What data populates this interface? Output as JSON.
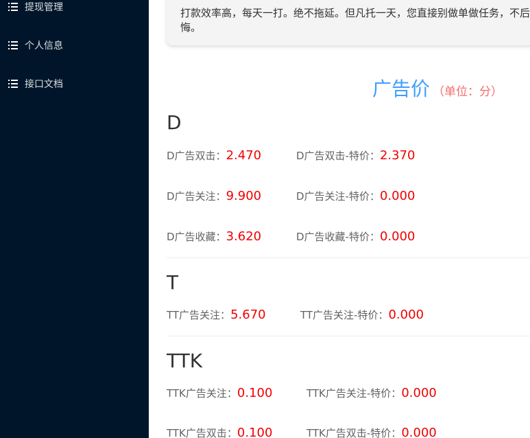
{
  "sidebar": {
    "items": [
      {
        "label": "提现管理",
        "icon": "list-icon"
      },
      {
        "label": "个人信息",
        "icon": "list-icon"
      },
      {
        "label": "接口文档",
        "icon": "list-icon"
      }
    ]
  },
  "notice": {
    "text": "打款效率高，每天一打。绝不拖延。但凡托一天，您直接别做单做任务，不后悔。"
  },
  "price": {
    "title": "广告价",
    "unit": "（单位：分）",
    "groups": [
      {
        "name": "D",
        "rows": [
          [
            {
              "label": "D广告双击：",
              "value": "2.470"
            },
            {
              "label": "D广告双击-特价：",
              "value": "2.370"
            }
          ],
          [
            {
              "label": "D广告关注：",
              "value": "9.900"
            },
            {
              "label": "D广告关注-特价：",
              "value": "0.000"
            }
          ],
          [
            {
              "label": "D广告收藏：",
              "value": "3.620"
            },
            {
              "label": "D广告收藏-特价：",
              "value": "0.000"
            }
          ]
        ]
      },
      {
        "name": "T",
        "rows": [
          [
            {
              "label": "TT广告关注：",
              "value": "5.670"
            },
            {
              "label": "TT广告关注-特价：",
              "value": "0.000"
            }
          ]
        ]
      },
      {
        "name": "TTK",
        "rows": [
          [
            {
              "label": "TTK广告关注：",
              "value": "0.100"
            },
            {
              "label": "TTK广告关注-特价：",
              "value": "0.000"
            }
          ],
          [
            {
              "label": "TTK广告双击：",
              "value": "0.100"
            },
            {
              "label": "TTK广告双击-特价：",
              "value": "0.000"
            }
          ]
        ]
      }
    ]
  },
  "colors": {
    "sidebar_bg": "#001529",
    "title_blue": "#409eff",
    "unit_red": "#f56c6c",
    "value_red": "#f00000"
  }
}
